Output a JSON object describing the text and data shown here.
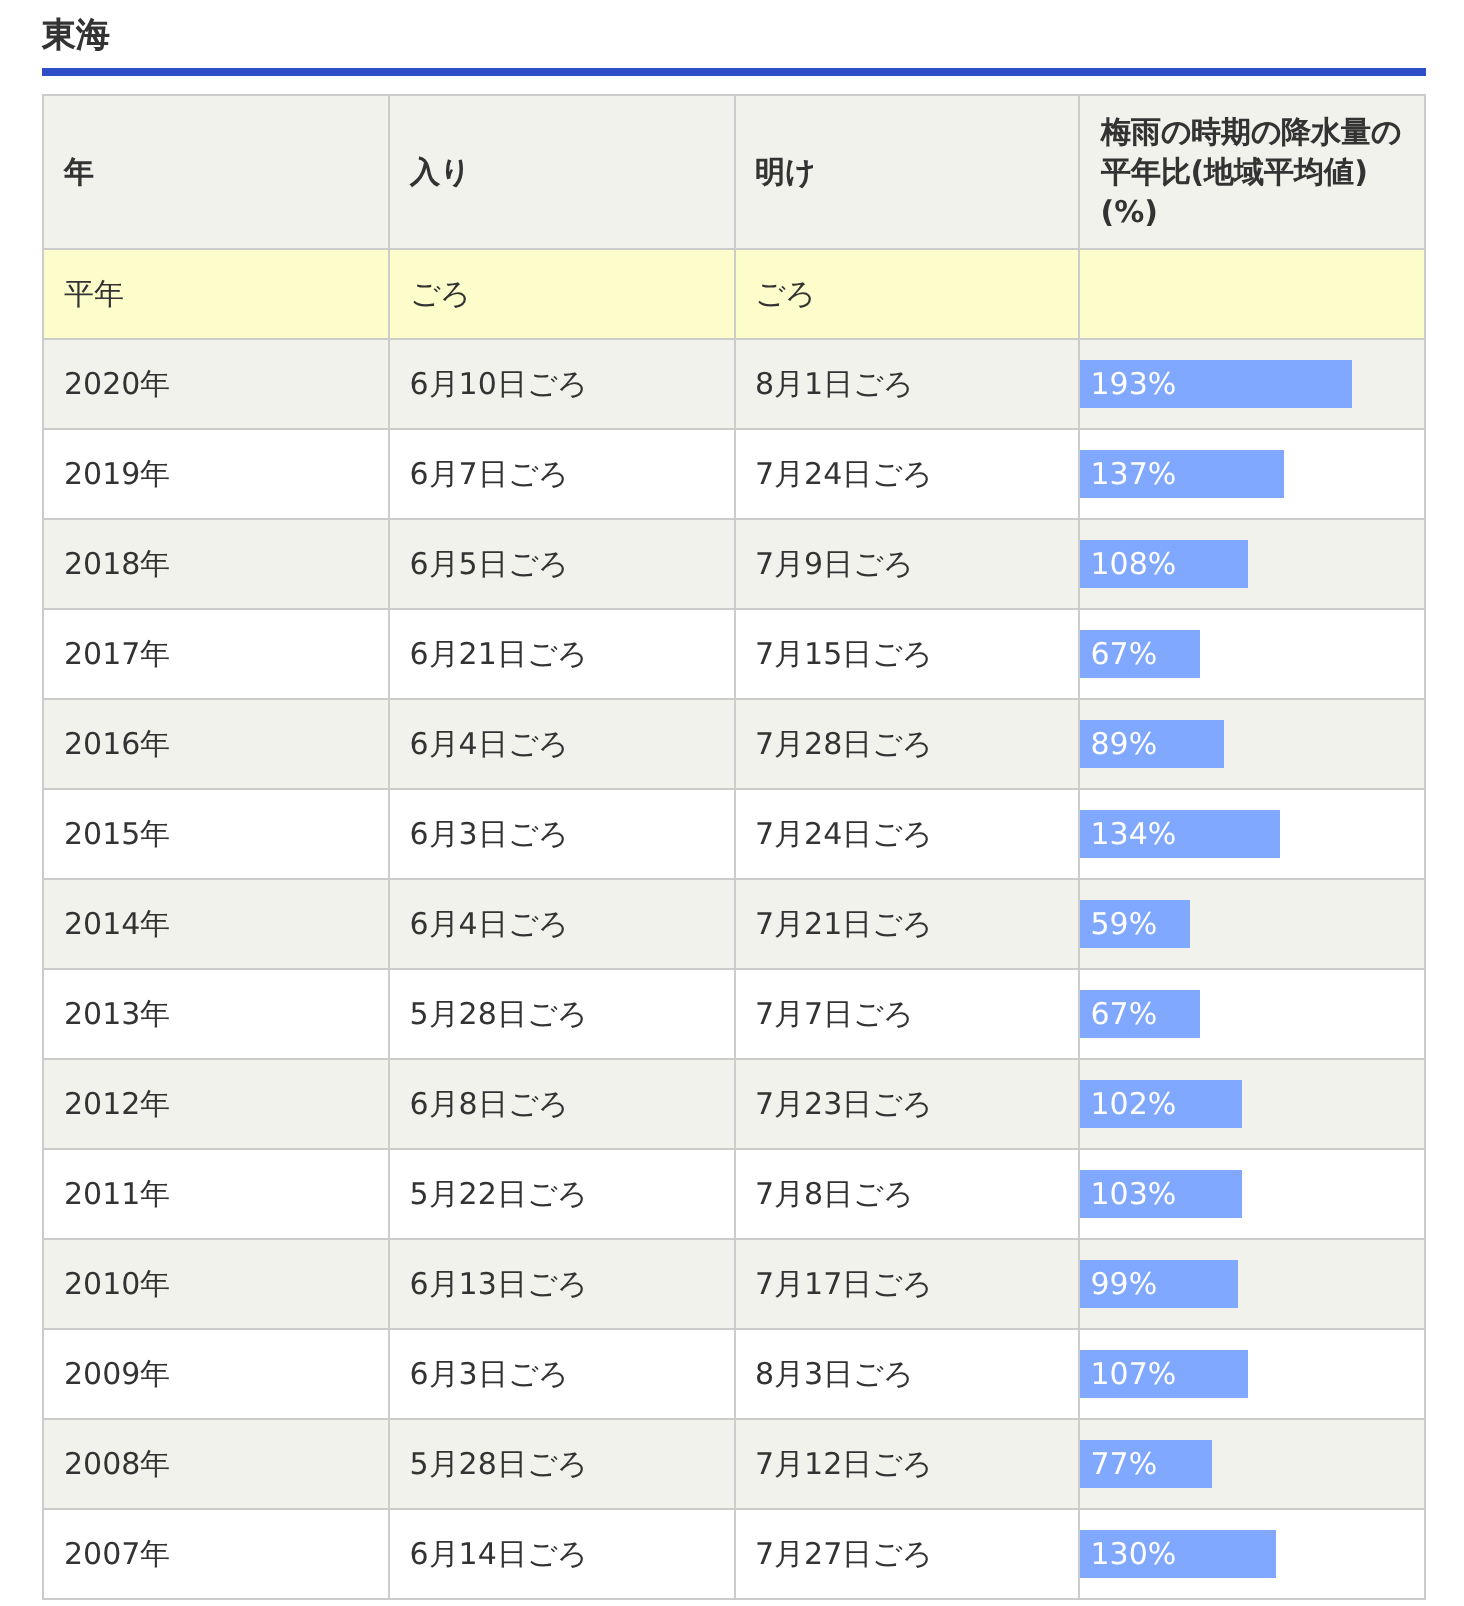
{
  "heading": "東海",
  "table": {
    "columns": [
      "年",
      "入り",
      "明け",
      "梅雨の時期の降水量の平年比(地域平均値)(%)"
    ],
    "rows": [
      {
        "kind": "normal",
        "year": "平年",
        "start": "ごろ",
        "end": "ごろ"
      },
      {
        "kind": "year",
        "year": "2020年",
        "start": "6月10日ごろ",
        "end": "8月1日ごろ",
        "ratio": "193%",
        "level": 0.79
      },
      {
        "kind": "year",
        "year": "2019年",
        "start": "6月7日ごろ",
        "end": "7月24日ごろ",
        "ratio": "137%",
        "level": 0.59
      },
      {
        "kind": "year",
        "year": "2018年",
        "start": "6月5日ごろ",
        "end": "7月9日ごろ",
        "ratio": "108%",
        "level": 0.49
      },
      {
        "kind": "year",
        "year": "2017年",
        "start": "6月21日ごろ",
        "end": "7月15日ごろ",
        "ratio": "67%",
        "level": 0.35
      },
      {
        "kind": "year",
        "year": "2016年",
        "start": "6月4日ごろ",
        "end": "7月28日ごろ",
        "ratio": "89%",
        "level": 0.42
      },
      {
        "kind": "year",
        "year": "2015年",
        "start": "6月3日ごろ",
        "end": "7月24日ごろ",
        "ratio": "134%",
        "level": 0.58
      },
      {
        "kind": "year",
        "year": "2014年",
        "start": "6月4日ごろ",
        "end": "7月21日ごろ",
        "ratio": "59%",
        "level": 0.32
      },
      {
        "kind": "year",
        "year": "2013年",
        "start": "5月28日ごろ",
        "end": "7月7日ごろ",
        "ratio": "67%",
        "level": 0.35
      },
      {
        "kind": "year",
        "year": "2012年",
        "start": "6月8日ごろ",
        "end": "7月23日ごろ",
        "ratio": "102%",
        "level": 0.47
      },
      {
        "kind": "year",
        "year": "2011年",
        "start": "5月22日ごろ",
        "end": "7月8日ごろ",
        "ratio": "103%",
        "level": 0.47
      },
      {
        "kind": "year",
        "year": "2010年",
        "start": "6月13日ごろ",
        "end": "7月17日ごろ",
        "ratio": "99%",
        "level": 0.46
      },
      {
        "kind": "year",
        "year": "2009年",
        "start": "6月3日ごろ",
        "end": "8月3日ごろ",
        "ratio": "107%",
        "level": 0.49
      },
      {
        "kind": "year",
        "year": "2008年",
        "start": "5月28日ごろ",
        "end": "7月12日ごろ",
        "ratio": "77%",
        "level": 0.38
      },
      {
        "kind": "year",
        "year": "2007年",
        "start": "6月14日ごろ",
        "end": "7月27日ごろ",
        "ratio": "130%",
        "level": 0.57
      }
    ]
  }
}
